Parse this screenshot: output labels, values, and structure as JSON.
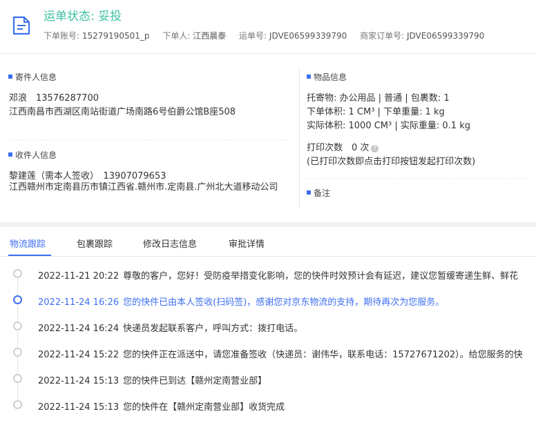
{
  "header": {
    "status": "运单状态: 妥投",
    "meta": [
      {
        "label": "下单账号:",
        "value": "15279190501_p"
      },
      {
        "label": "下单人:",
        "value": "江西晨泰"
      },
      {
        "label": "运单号:",
        "value": "JDVE06599339790"
      },
      {
        "label": "商家订单号:",
        "value": "JDVE06599339790"
      }
    ]
  },
  "sender": {
    "title": "寄件人信息",
    "name_phone": "邓浪　13576287700",
    "address": "江西南昌市西湖区南站街道广场南路6号伯爵公馆B座508"
  },
  "receiver": {
    "title": "收件人信息",
    "name_phone": "黎建莲（需本人签收）　13907079653",
    "address": "江西赣州市定南县历市镇江西省.赣州市.定南县.广州北大道移动公司"
  },
  "goods": {
    "title": "物品信息",
    "line1": "托寄物:  办公用品 | 普通 | 包裹数:  1",
    "line2": "下单体积:    1 CM³ | 下单重量:   1 kg",
    "line3": "实际体积:    1000 CM³ | 实际重量:   0.1 kg",
    "print_count": "打印次数　0 次",
    "print_note": "(已打印次数即点击打印按钮发起打印次数)"
  },
  "remark": {
    "title": "备注"
  },
  "tabs": [
    "物流跟踪",
    "包裹跟踪",
    "修改日志信息",
    "审批详情"
  ],
  "tracking": [
    {
      "time": "2022-11-21 20:22",
      "text": "尊敬的客户，您好！受防疫举措变化影响，您的快件时效预计会有延迟，建议您暂缓寄递生鲜、鲜花"
    },
    {
      "time": "2022-11-24 16:26",
      "text": "您的快件已由本人签收(扫码签)，感谢您对京东物流的支持，期待再次为您服务。"
    },
    {
      "time": "2022-11-24 16:24",
      "text": "快递员发起联系客户，呼叫方式：拨打电话。"
    },
    {
      "time": "2022-11-24 15:22",
      "text": "您的快件正在派送中，请您准备签收（快递员：谢伟华，联系电话：15727671202）。给您服务的快"
    },
    {
      "time": "2022-11-24 15:13",
      "text": "您的快件已到达【赣州定南营业部】"
    },
    {
      "time": "2022-11-24 15:13",
      "text": "您的快件在【赣州定南营业部】收货完成"
    }
  ],
  "colors": {
    "accent": "#3c6ff0",
    "status": "#3dc1a3"
  }
}
